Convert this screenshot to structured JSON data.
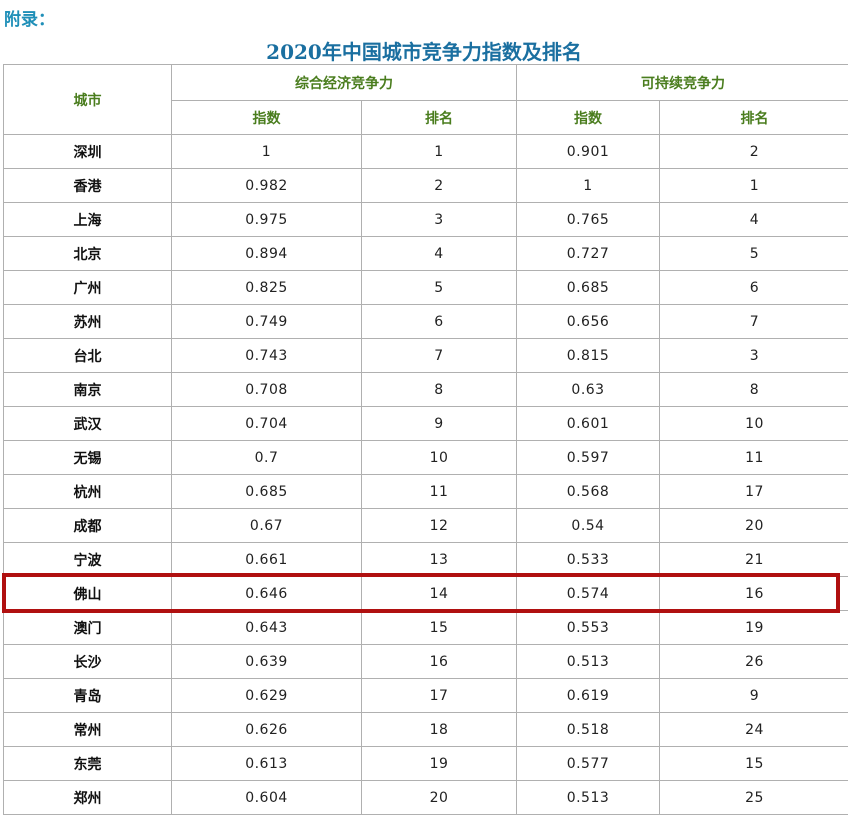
{
  "appendix_label": "附录：",
  "table_title": "2020年中国城市竞争力指数及排名",
  "header": {
    "city": "城市",
    "group_economic": "综合经济竞争力",
    "group_sustainable": "可持续竞争力",
    "index": "指数",
    "rank": "排名"
  },
  "highlight_color": "#b01010",
  "highlighted_city": "佛山",
  "rows": [
    {
      "city": "深圳",
      "econ_index": "1",
      "econ_rank": "1",
      "sus_index": "0.901",
      "sus_rank": "2"
    },
    {
      "city": "香港",
      "econ_index": "0.982",
      "econ_rank": "2",
      "sus_index": "1",
      "sus_rank": "1"
    },
    {
      "city": "上海",
      "econ_index": "0.975",
      "econ_rank": "3",
      "sus_index": "0.765",
      "sus_rank": "4"
    },
    {
      "city": "北京",
      "econ_index": "0.894",
      "econ_rank": "4",
      "sus_index": "0.727",
      "sus_rank": "5"
    },
    {
      "city": "广州",
      "econ_index": "0.825",
      "econ_rank": "5",
      "sus_index": "0.685",
      "sus_rank": "6"
    },
    {
      "city": "苏州",
      "econ_index": "0.749",
      "econ_rank": "6",
      "sus_index": "0.656",
      "sus_rank": "7"
    },
    {
      "city": "台北",
      "econ_index": "0.743",
      "econ_rank": "7",
      "sus_index": "0.815",
      "sus_rank": "3"
    },
    {
      "city": "南京",
      "econ_index": "0.708",
      "econ_rank": "8",
      "sus_index": "0.63",
      "sus_rank": "8"
    },
    {
      "city": "武汉",
      "econ_index": "0.704",
      "econ_rank": "9",
      "sus_index": "0.601",
      "sus_rank": "10"
    },
    {
      "city": "无锡",
      "econ_index": "0.7",
      "econ_rank": "10",
      "sus_index": "0.597",
      "sus_rank": "11"
    },
    {
      "city": "杭州",
      "econ_index": "0.685",
      "econ_rank": "11",
      "sus_index": "0.568",
      "sus_rank": "17"
    },
    {
      "city": "成都",
      "econ_index": "0.67",
      "econ_rank": "12",
      "sus_index": "0.54",
      "sus_rank": "20"
    },
    {
      "city": "宁波",
      "econ_index": "0.661",
      "econ_rank": "13",
      "sus_index": "0.533",
      "sus_rank": "21"
    },
    {
      "city": "佛山",
      "econ_index": "0.646",
      "econ_rank": "14",
      "sus_index": "0.574",
      "sus_rank": "16"
    },
    {
      "city": "澳门",
      "econ_index": "0.643",
      "econ_rank": "15",
      "sus_index": "0.553",
      "sus_rank": "19"
    },
    {
      "city": "长沙",
      "econ_index": "0.639",
      "econ_rank": "16",
      "sus_index": "0.513",
      "sus_rank": "26"
    },
    {
      "city": "青岛",
      "econ_index": "0.629",
      "econ_rank": "17",
      "sus_index": "0.619",
      "sus_rank": "9"
    },
    {
      "city": "常州",
      "econ_index": "0.626",
      "econ_rank": "18",
      "sus_index": "0.518",
      "sus_rank": "24"
    },
    {
      "city": "东莞",
      "econ_index": "0.613",
      "econ_rank": "19",
      "sus_index": "0.577",
      "sus_rank": "15"
    },
    {
      "city": "郑州",
      "econ_index": "0.604",
      "econ_rank": "20",
      "sus_index": "0.513",
      "sus_rank": "25"
    }
  ]
}
